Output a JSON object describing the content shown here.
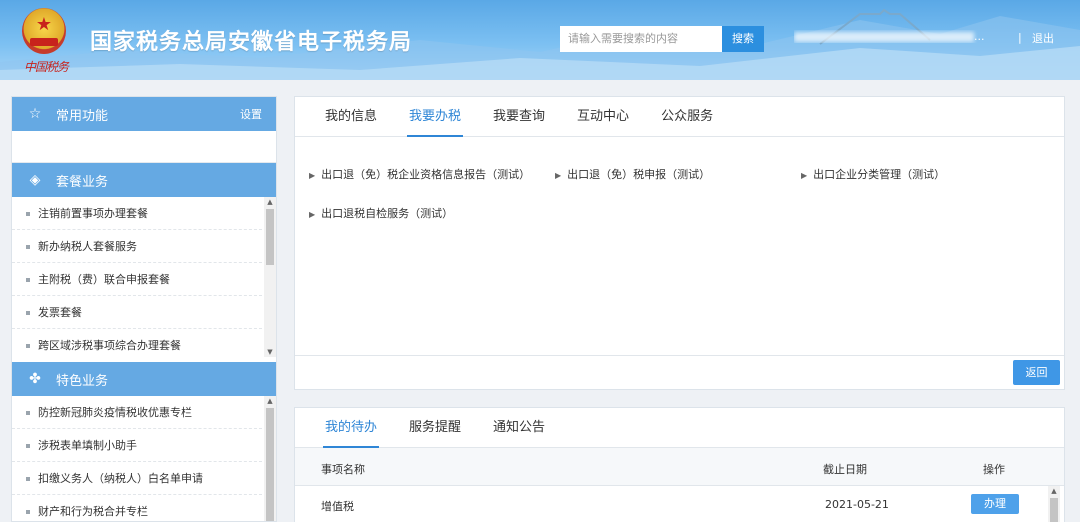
{
  "header": {
    "calligraphy": "中国税务",
    "site_title": "国家税务总局安徽省电子税务局",
    "search_placeholder": "请输入需要搜索的内容",
    "search_button": "搜索",
    "user_suffix": "...",
    "separator": "|",
    "logout": "退出"
  },
  "sidebar": {
    "common": {
      "title": "常用功能",
      "setting": "设置"
    },
    "package": {
      "title": "套餐业务",
      "items": [
        "注销前置事项办理套餐",
        "新办纳税人套餐服务",
        "主附税（费）联合申报套餐",
        "发票套餐",
        "跨区域涉税事项综合办理套餐"
      ]
    },
    "special": {
      "title": "特色业务",
      "items": [
        "防控新冠肺炎疫情税收优惠专栏",
        "涉税表单填制小助手",
        "扣缴义务人（纳税人）白名单申请",
        "财产和行为税合并专栏"
      ]
    }
  },
  "main": {
    "tabs": [
      "我的信息",
      "我要办税",
      "我要查询",
      "互动中心",
      "公众服务"
    ],
    "active_tab": "我要办税",
    "links": [
      "出口退（免）税企业资格信息报告（测试）",
      "出口退（免）税申报（测试）",
      "出口企业分类管理（测试）",
      "出口退税自检服务（测试）"
    ],
    "back_button": "返回"
  },
  "todo": {
    "tabs": [
      "我的待办",
      "服务提醒",
      "通知公告"
    ],
    "active_tab": "我的待办",
    "columns": {
      "name": "事项名称",
      "deadline": "截止日期",
      "action": "操作"
    },
    "rows": [
      {
        "name": "增值税",
        "deadline": "2021-05-21",
        "action": "办理"
      }
    ]
  },
  "colors": {
    "header_blue": "#5aa8e6",
    "accent": "#2f86d6",
    "sidebar_header": "#65a9e3"
  }
}
